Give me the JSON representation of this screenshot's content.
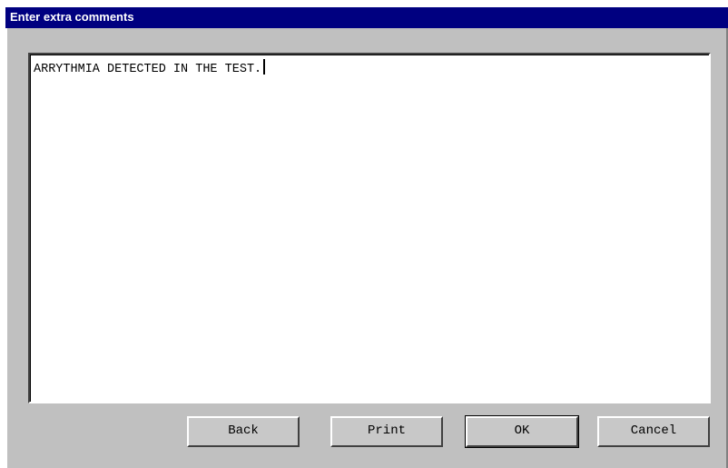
{
  "window": {
    "title": "Enter extra comments"
  },
  "comment": {
    "value": "ARRYTHMIA DETECTED IN THE TEST."
  },
  "buttons": {
    "back": "Back",
    "print": "Print",
    "ok": "OK",
    "cancel": "Cancel"
  },
  "colors": {
    "titlebar": "#000080",
    "face": "#c0c0c0"
  }
}
